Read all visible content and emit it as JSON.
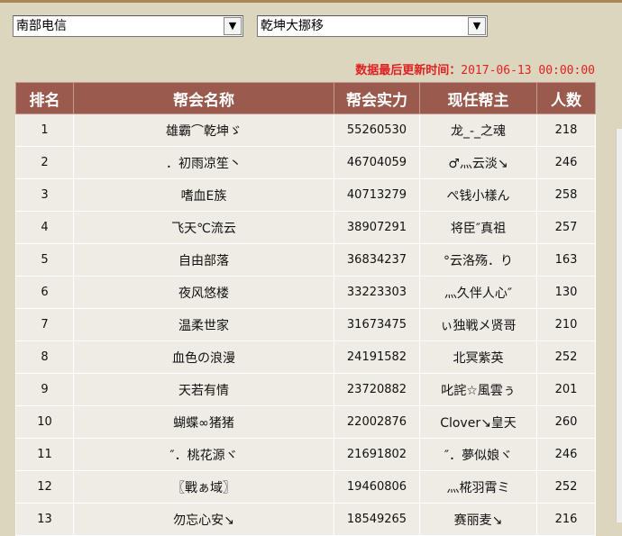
{
  "filters": {
    "region": "南部电信",
    "server": "乾坤大挪移"
  },
  "update_label": "数据最后更新时间：",
  "update_time": "2017-06-13 00:00:00",
  "headers": [
    "排名",
    "帮会名称",
    "帮会实力",
    "现任帮主",
    "人数"
  ],
  "rows": [
    [
      "1",
      "雄霸⌒乾坤ゞ",
      "55260530",
      "龙_-_之魂",
      "218"
    ],
    [
      "2",
      "．初雨凉笙丶",
      "46704059",
      "♂灬云淡↘",
      "246"
    ],
    [
      "3",
      "嗜血E族",
      "40713279",
      "ぺ钱小樣ん",
      "258"
    ],
    [
      "4",
      "飞天℃流云",
      "38907291",
      "将臣″真祖",
      "257"
    ],
    [
      "5",
      "自由部落",
      "36834237",
      "°云洛殇．り",
      "163"
    ],
    [
      "6",
      "夜风悠楼",
      "33223303",
      "灬久伴人心″",
      "130"
    ],
    [
      "7",
      "温柔世家",
      "31673475",
      "ぃ独戦メ贤哥",
      "210"
    ],
    [
      "8",
      "血色の浪漫",
      "24191582",
      "北冥紫英",
      "252"
    ],
    [
      "9",
      "天若有情",
      "23720882",
      "叱詫☆風雲ぅ",
      "201"
    ],
    [
      "10",
      "蝴蝶∞猪猪",
      "22002876",
      "Clover↘皇天",
      "260"
    ],
    [
      "11",
      "″．桃花源ヾ",
      "21691802",
      "″．夢似娘ヾ",
      "246"
    ],
    [
      "12",
      "〖戰ぁ域〗",
      "19460806",
      "灬椛羽霄ミ",
      "252"
    ],
    [
      "13",
      "勿忘心安↘",
      "18549265",
      "赛丽麦↘",
      "216"
    ]
  ]
}
